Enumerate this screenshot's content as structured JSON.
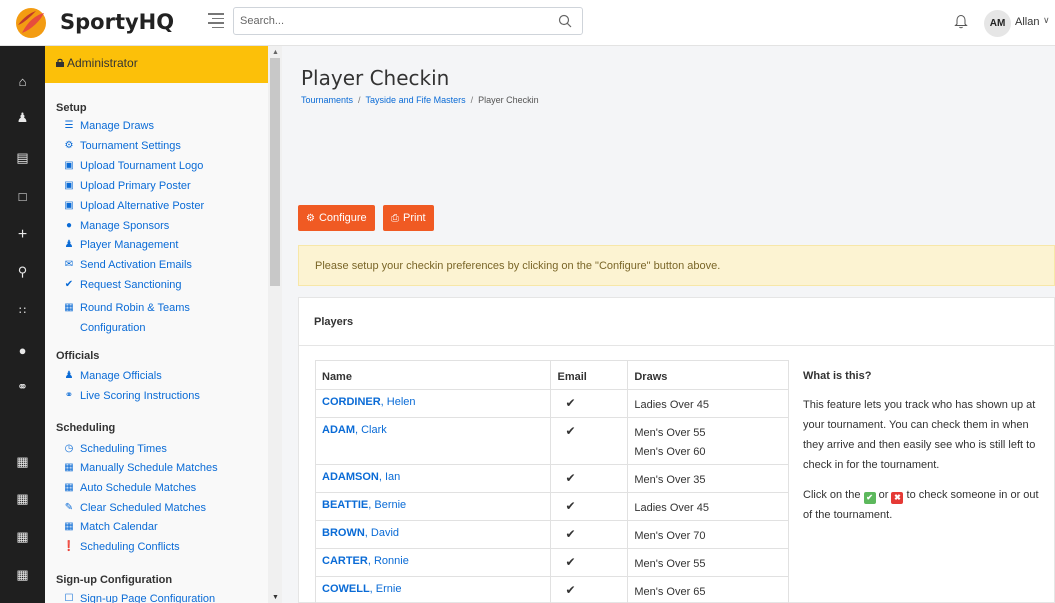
{
  "app": {
    "brand": "SportyHQ",
    "search_placeholder": "Search...",
    "user_initials": "AM",
    "user_name": "Allan"
  },
  "rail_icons": [
    "home-icon",
    "user-icon",
    "list-icon",
    "calendar-icon",
    "plus-icon",
    "trophy-icon",
    "grid-icon",
    "location-pin-icon",
    "globe-icon",
    "table-icon",
    "table-icon",
    "table-icon",
    "table-icon"
  ],
  "sidemenu": {
    "admin_label": "Administrator",
    "sections": {
      "setup": "Setup",
      "officials": "Officials",
      "scheduling": "Scheduling",
      "signup": "Sign-up Configuration"
    },
    "setup_items": [
      {
        "label": "Manage Draws",
        "icon": "list-icon"
      },
      {
        "label": "Tournament Settings",
        "icon": "gear-icon"
      },
      {
        "label": "Upload Tournament Logo",
        "icon": "image-icon"
      },
      {
        "label": "Upload Primary Poster",
        "icon": "image-icon"
      },
      {
        "label": "Upload Alternative Poster",
        "icon": "image-icon"
      },
      {
        "label": "Manage Sponsors",
        "icon": "circle-icon"
      },
      {
        "label": "Player Management",
        "icon": "users-icon"
      },
      {
        "label": "Send Activation Emails",
        "icon": "envelope-icon"
      },
      {
        "label": "Request Sanctioning",
        "icon": "check-circle-icon"
      },
      {
        "label": "Round Robin & Teams Configuration",
        "icon": "table-icon"
      }
    ],
    "officials_items": [
      {
        "label": "Manage Officials",
        "icon": "users-icon"
      },
      {
        "label": "Live Scoring Instructions",
        "icon": "lifebuoy-icon"
      }
    ],
    "scheduling_items": [
      {
        "label": "Scheduling Times",
        "icon": "clock-icon"
      },
      {
        "label": "Manually Schedule Matches",
        "icon": "calendar-icon"
      },
      {
        "label": "Auto Schedule Matches",
        "icon": "calendar-icon"
      },
      {
        "label": "Clear Scheduled Matches",
        "icon": "eraser-icon"
      },
      {
        "label": "Match Calendar",
        "icon": "calendar-icon"
      },
      {
        "label": "Scheduling Conflicts",
        "icon": "alert-icon"
      }
    ],
    "signup_items": [
      {
        "label": "Sign-up Page Configuration",
        "icon": "file-icon"
      }
    ]
  },
  "page": {
    "title": "Player Checkin",
    "breadcrumb": [
      "Tournaments",
      "Tayside and Fife Masters",
      "Player Checkin"
    ],
    "configure_label": "Configure",
    "print_label": "Print",
    "alert": "Please setup your checkin preferences by clicking on the \"Configure\" button above.",
    "card_title": "Players"
  },
  "table": {
    "headers": {
      "name": "Name",
      "email": "Email",
      "draws": "Draws"
    },
    "rows": [
      {
        "surname": "CORDINER",
        "first": ", Helen",
        "email": "✔",
        "draws": [
          "Ladies Over 45"
        ]
      },
      {
        "surname": "ADAM",
        "first": ", Clark",
        "email": "✔",
        "draws": [
          "Men's Over 55",
          "Men's Over 60"
        ]
      },
      {
        "surname": "ADAMSON",
        "first": ", Ian",
        "email": "✔",
        "draws": [
          "Men's Over 35"
        ]
      },
      {
        "surname": "BEATTIE",
        "first": ", Bernie",
        "email": "✔",
        "draws": [
          "Ladies Over 45"
        ]
      },
      {
        "surname": "BROWN",
        "first": ", David",
        "email": "✔",
        "draws": [
          "Men's Over 70"
        ]
      },
      {
        "surname": "CARTER",
        "first": ", Ronnie",
        "email": "✔",
        "draws": [
          "Men's Over 55"
        ]
      },
      {
        "surname": "COWELL",
        "first": ", Ernie",
        "email": "✔",
        "draws": [
          "Men's Over 65"
        ]
      }
    ]
  },
  "info": {
    "title": "What is this?",
    "body": "This feature lets you track who has shown up at your tournament. You can check them in when they arrive and then easily see who is still left to check in for the tournament.",
    "click_prefix": "Click on the",
    "click_or": "or",
    "click_suffix": "to check someone in or out of the tournament."
  },
  "colors": {
    "accent": "#f05a23",
    "admin_bar": "#fcc009",
    "link": "#0a6bd6",
    "rail": "#1f1f1f",
    "check_in": "#5cb85c",
    "check_out": "#e53935"
  }
}
